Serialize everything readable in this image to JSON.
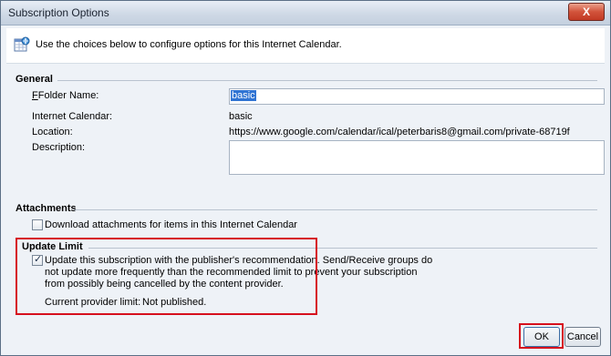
{
  "window": {
    "title": "Subscription Options",
    "close_label": "X"
  },
  "info": {
    "text": "Use the choices below to configure options for this Internet Calendar."
  },
  "general": {
    "header": "General",
    "folder_name_label": "Folder Name:",
    "folder_name_value": "basic",
    "internet_calendar_label": "Internet Calendar:",
    "internet_calendar_value": "basic",
    "location_label": "Location:",
    "location_value": "https://www.google.com/calendar/ical/peterbaris8@gmail.com/private-68719f",
    "description_label": "Description:",
    "description_value": ""
  },
  "attachments": {
    "header": "Attachments",
    "download_label": "Download attachments for items in this Internet Calendar",
    "download_checked": false
  },
  "update_limit": {
    "header": "Update Limit",
    "checkbox_line1": "Update this subscription with the publisher's recommendation. Send/Receive groups do",
    "checkbox_line2": "not update more frequently than the recommended limit to prevent your subscription",
    "checkbox_line3": "from possibly being cancelled by the content provider.",
    "checked": true,
    "provider_limit_label": "Current provider limit:",
    "provider_limit_value": "Not published."
  },
  "buttons": {
    "ok": "OK",
    "cancel": "Cancel"
  },
  "colors": {
    "highlight_border": "#d6101d",
    "selection": "#3074d3"
  },
  "icons": {
    "info": "calendar-icon",
    "close": "close-icon"
  }
}
